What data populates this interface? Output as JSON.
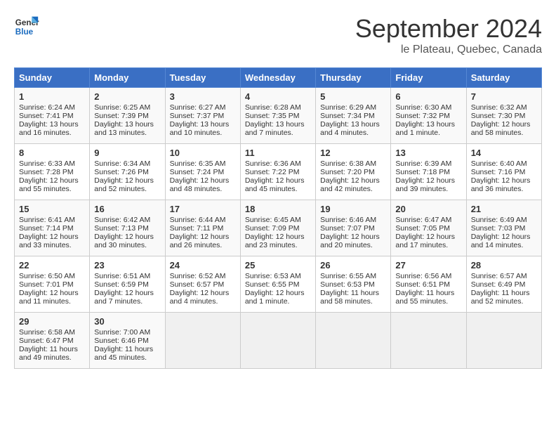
{
  "header": {
    "logo_line1": "General",
    "logo_line2": "Blue",
    "month": "September 2024",
    "location": "le Plateau, Quebec, Canada"
  },
  "days_of_week": [
    "Sunday",
    "Monday",
    "Tuesday",
    "Wednesday",
    "Thursday",
    "Friday",
    "Saturday"
  ],
  "weeks": [
    [
      {
        "day": "1",
        "lines": [
          "Sunrise: 6:24 AM",
          "Sunset: 7:41 PM",
          "Daylight: 13 hours",
          "and 16 minutes."
        ]
      },
      {
        "day": "2",
        "lines": [
          "Sunrise: 6:25 AM",
          "Sunset: 7:39 PM",
          "Daylight: 13 hours",
          "and 13 minutes."
        ]
      },
      {
        "day": "3",
        "lines": [
          "Sunrise: 6:27 AM",
          "Sunset: 7:37 PM",
          "Daylight: 13 hours",
          "and 10 minutes."
        ]
      },
      {
        "day": "4",
        "lines": [
          "Sunrise: 6:28 AM",
          "Sunset: 7:35 PM",
          "Daylight: 13 hours",
          "and 7 minutes."
        ]
      },
      {
        "day": "5",
        "lines": [
          "Sunrise: 6:29 AM",
          "Sunset: 7:34 PM",
          "Daylight: 13 hours",
          "and 4 minutes."
        ]
      },
      {
        "day": "6",
        "lines": [
          "Sunrise: 6:30 AM",
          "Sunset: 7:32 PM",
          "Daylight: 13 hours",
          "and 1 minute."
        ]
      },
      {
        "day": "7",
        "lines": [
          "Sunrise: 6:32 AM",
          "Sunset: 7:30 PM",
          "Daylight: 12 hours",
          "and 58 minutes."
        ]
      }
    ],
    [
      {
        "day": "8",
        "lines": [
          "Sunrise: 6:33 AM",
          "Sunset: 7:28 PM",
          "Daylight: 12 hours",
          "and 55 minutes."
        ]
      },
      {
        "day": "9",
        "lines": [
          "Sunrise: 6:34 AM",
          "Sunset: 7:26 PM",
          "Daylight: 12 hours",
          "and 52 minutes."
        ]
      },
      {
        "day": "10",
        "lines": [
          "Sunrise: 6:35 AM",
          "Sunset: 7:24 PM",
          "Daylight: 12 hours",
          "and 48 minutes."
        ]
      },
      {
        "day": "11",
        "lines": [
          "Sunrise: 6:36 AM",
          "Sunset: 7:22 PM",
          "Daylight: 12 hours",
          "and 45 minutes."
        ]
      },
      {
        "day": "12",
        "lines": [
          "Sunrise: 6:38 AM",
          "Sunset: 7:20 PM",
          "Daylight: 12 hours",
          "and 42 minutes."
        ]
      },
      {
        "day": "13",
        "lines": [
          "Sunrise: 6:39 AM",
          "Sunset: 7:18 PM",
          "Daylight: 12 hours",
          "and 39 minutes."
        ]
      },
      {
        "day": "14",
        "lines": [
          "Sunrise: 6:40 AM",
          "Sunset: 7:16 PM",
          "Daylight: 12 hours",
          "and 36 minutes."
        ]
      }
    ],
    [
      {
        "day": "15",
        "lines": [
          "Sunrise: 6:41 AM",
          "Sunset: 7:14 PM",
          "Daylight: 12 hours",
          "and 33 minutes."
        ]
      },
      {
        "day": "16",
        "lines": [
          "Sunrise: 6:42 AM",
          "Sunset: 7:13 PM",
          "Daylight: 12 hours",
          "and 30 minutes."
        ]
      },
      {
        "day": "17",
        "lines": [
          "Sunrise: 6:44 AM",
          "Sunset: 7:11 PM",
          "Daylight: 12 hours",
          "and 26 minutes."
        ]
      },
      {
        "day": "18",
        "lines": [
          "Sunrise: 6:45 AM",
          "Sunset: 7:09 PM",
          "Daylight: 12 hours",
          "and 23 minutes."
        ]
      },
      {
        "day": "19",
        "lines": [
          "Sunrise: 6:46 AM",
          "Sunset: 7:07 PM",
          "Daylight: 12 hours",
          "and 20 minutes."
        ]
      },
      {
        "day": "20",
        "lines": [
          "Sunrise: 6:47 AM",
          "Sunset: 7:05 PM",
          "Daylight: 12 hours",
          "and 17 minutes."
        ]
      },
      {
        "day": "21",
        "lines": [
          "Sunrise: 6:49 AM",
          "Sunset: 7:03 PM",
          "Daylight: 12 hours",
          "and 14 minutes."
        ]
      }
    ],
    [
      {
        "day": "22",
        "lines": [
          "Sunrise: 6:50 AM",
          "Sunset: 7:01 PM",
          "Daylight: 12 hours",
          "and 11 minutes."
        ]
      },
      {
        "day": "23",
        "lines": [
          "Sunrise: 6:51 AM",
          "Sunset: 6:59 PM",
          "Daylight: 12 hours",
          "and 7 minutes."
        ]
      },
      {
        "day": "24",
        "lines": [
          "Sunrise: 6:52 AM",
          "Sunset: 6:57 PM",
          "Daylight: 12 hours",
          "and 4 minutes."
        ]
      },
      {
        "day": "25",
        "lines": [
          "Sunrise: 6:53 AM",
          "Sunset: 6:55 PM",
          "Daylight: 12 hours",
          "and 1 minute."
        ]
      },
      {
        "day": "26",
        "lines": [
          "Sunrise: 6:55 AM",
          "Sunset: 6:53 PM",
          "Daylight: 11 hours",
          "and 58 minutes."
        ]
      },
      {
        "day": "27",
        "lines": [
          "Sunrise: 6:56 AM",
          "Sunset: 6:51 PM",
          "Daylight: 11 hours",
          "and 55 minutes."
        ]
      },
      {
        "day": "28",
        "lines": [
          "Sunrise: 6:57 AM",
          "Sunset: 6:49 PM",
          "Daylight: 11 hours",
          "and 52 minutes."
        ]
      }
    ],
    [
      {
        "day": "29",
        "lines": [
          "Sunrise: 6:58 AM",
          "Sunset: 6:47 PM",
          "Daylight: 11 hours",
          "and 49 minutes."
        ]
      },
      {
        "day": "30",
        "lines": [
          "Sunrise: 7:00 AM",
          "Sunset: 6:46 PM",
          "Daylight: 11 hours",
          "and 45 minutes."
        ]
      },
      {
        "day": "",
        "lines": []
      },
      {
        "day": "",
        "lines": []
      },
      {
        "day": "",
        "lines": []
      },
      {
        "day": "",
        "lines": []
      },
      {
        "day": "",
        "lines": []
      }
    ]
  ]
}
